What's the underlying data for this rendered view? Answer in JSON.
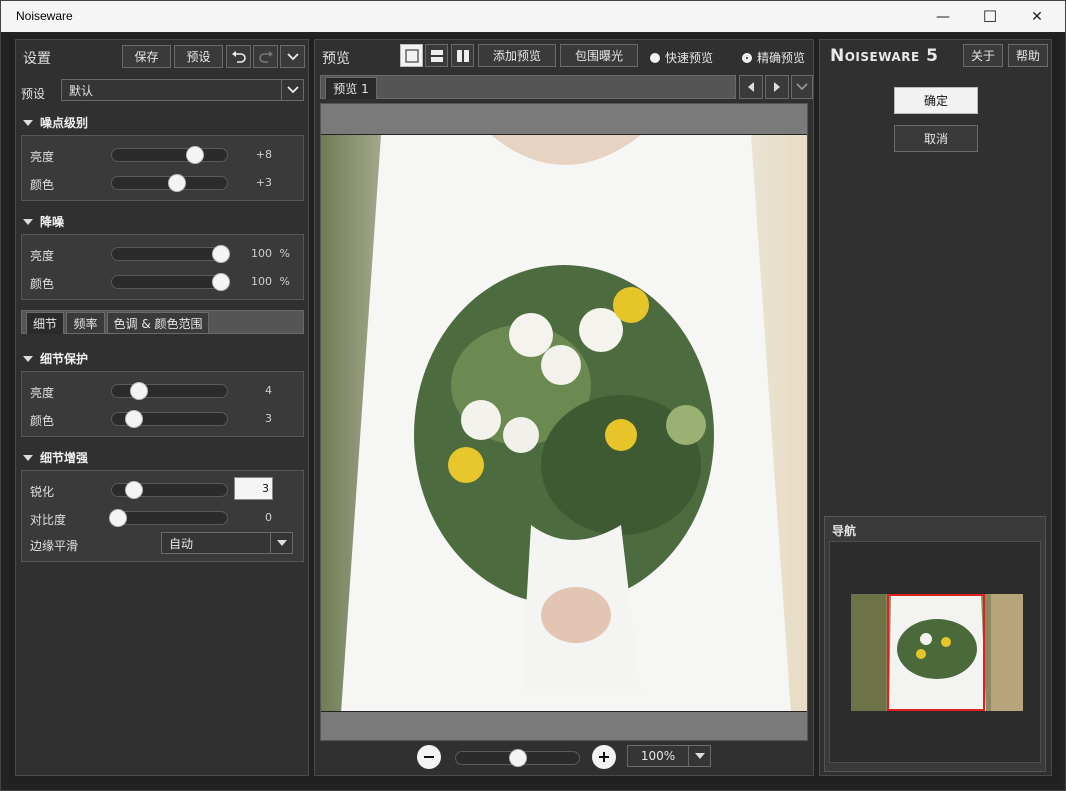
{
  "window": {
    "title": "Noiseware",
    "minimize": "—",
    "maximize": "☐",
    "close": "✕"
  },
  "settings": {
    "title": "设置",
    "save": "保存",
    "preset_btn": "预设",
    "undo_icon": "undo-icon",
    "redo_icon": "redo-icon",
    "preset_label": "预设",
    "preset_value": "默认"
  },
  "noise_level": {
    "heading": "噪点级别",
    "luminance_label": "亮度",
    "luminance_value": "+8",
    "luminance_fraction": 0.75,
    "color_label": "颜色",
    "color_value": "+3",
    "color_fraction": 0.57
  },
  "noise_reduction": {
    "heading": "降噪",
    "luminance_label": "亮度",
    "luminance_value": "100",
    "luminance_unit": "%",
    "luminance_fraction": 1.0,
    "color_label": "颜色",
    "color_value": "100",
    "color_unit": "%",
    "color_fraction": 1.0
  },
  "tabs": {
    "detail": "细节",
    "frequency": "频率",
    "tone_color": "色调 & 颜色范围"
  },
  "detail_protection": {
    "heading": "细节保护",
    "luminance_label": "亮度",
    "luminance_value": "4",
    "luminance_fraction": 0.2,
    "color_label": "颜色",
    "color_value": "3",
    "color_fraction": 0.16
  },
  "detail_enhance": {
    "heading": "细节增强",
    "sharpen_label": "锐化",
    "sharpen_value": "3",
    "sharpen_fraction": 0.16,
    "contrast_label": "对比度",
    "contrast_value": "0",
    "contrast_fraction": 0.0,
    "edge_label": "边缘平滑",
    "edge_value": "自动"
  },
  "preview": {
    "title": "预览",
    "add_preview": "添加预览",
    "bracket": "包围曝光",
    "fast_preview": "快速预览",
    "accurate_preview": "精确预览",
    "tab1": "预览 1",
    "zoom_value": "100%",
    "zoom_fraction": 0.5
  },
  "right": {
    "brand": "Noiseware 5",
    "about": "关于",
    "help": "帮助",
    "ok": "确定",
    "cancel": "取消",
    "navigator": "导航"
  }
}
